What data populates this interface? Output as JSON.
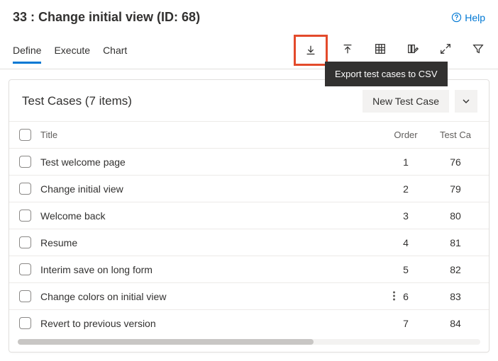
{
  "page": {
    "title": "33 : Change initial view (ID: 68)",
    "help_label": "Help"
  },
  "tabs": {
    "define": "Define",
    "execute": "Execute",
    "chart": "Chart"
  },
  "tooltip": {
    "export_csv": "Export test cases to CSV"
  },
  "panel": {
    "title": "Test Cases (7 items)",
    "new_button": "New Test Case"
  },
  "columns": {
    "title": "Title",
    "order": "Order",
    "test_case": "Test Ca"
  },
  "rows": [
    {
      "title": "Test welcome page",
      "order": "1",
      "tc": "76"
    },
    {
      "title": "Change initial view",
      "order": "2",
      "tc": "79"
    },
    {
      "title": "Welcome back",
      "order": "3",
      "tc": "80"
    },
    {
      "title": "Resume",
      "order": "4",
      "tc": "81"
    },
    {
      "title": "Interim save on long form",
      "order": "5",
      "tc": "82"
    },
    {
      "title": "Change colors on initial view",
      "order": "6",
      "tc": "83"
    },
    {
      "title": "Revert to previous version",
      "order": "7",
      "tc": "84"
    }
  ]
}
